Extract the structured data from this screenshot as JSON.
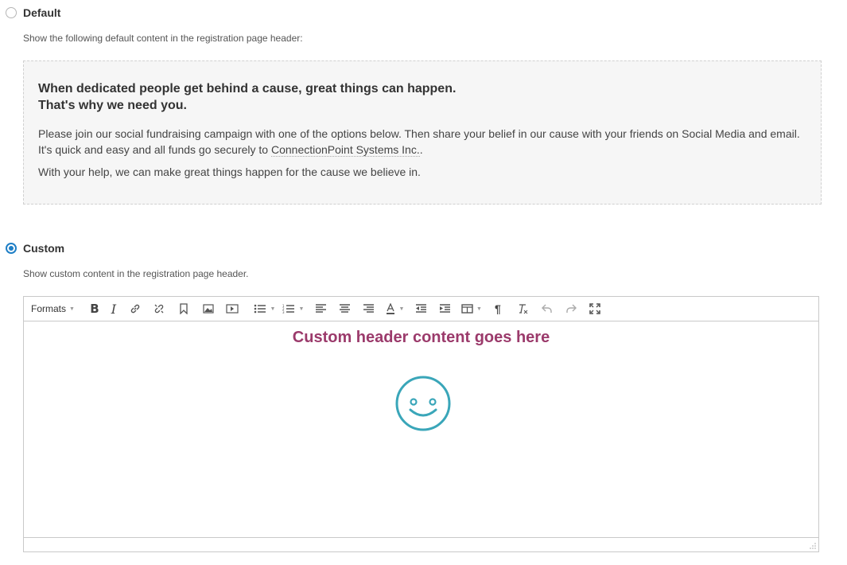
{
  "default_option": {
    "label": "Default",
    "hint": "Show the following default content in the registration page header:",
    "headline_line1": "When dedicated people get behind a cause, great things can happen.",
    "headline_line2": "That's why we need you.",
    "paragraph1_before": "Please join our social fundraising campaign with one of the options below. Then share your belief in our cause with your friends on Social Media and email. It's quick and easy and all funds go securely to ",
    "organization": "ConnectionPoint Systems Inc.",
    "paragraph1_after": ".",
    "paragraph2": "With your help, we can make great things happen for the cause we believe in."
  },
  "custom_option": {
    "label": "Custom",
    "hint": "Show custom content in the registration page header.",
    "selected": true
  },
  "editor": {
    "formats_label": "Formats",
    "heading_text": "Custom header content goes here",
    "smiley_color": "#3aa6b9",
    "heading_color": "#9b3a6b",
    "toolbar_icons": [
      "bold-icon",
      "italic-icon",
      "link-icon",
      "unlink-icon",
      "bookmark-icon",
      "image-icon",
      "media-icon",
      "bullet-list-icon",
      "numbered-list-icon",
      "align-left-icon",
      "align-center-icon",
      "align-right-icon",
      "text-color-icon",
      "outdent-icon",
      "indent-icon",
      "table-icon",
      "show-blocks-icon",
      "clear-format-icon",
      "undo-icon",
      "redo-icon",
      "fullscreen-icon"
    ]
  },
  "colors": {
    "radio_accent": "#1f7fc6",
    "box_background": "#f6f6f6"
  }
}
